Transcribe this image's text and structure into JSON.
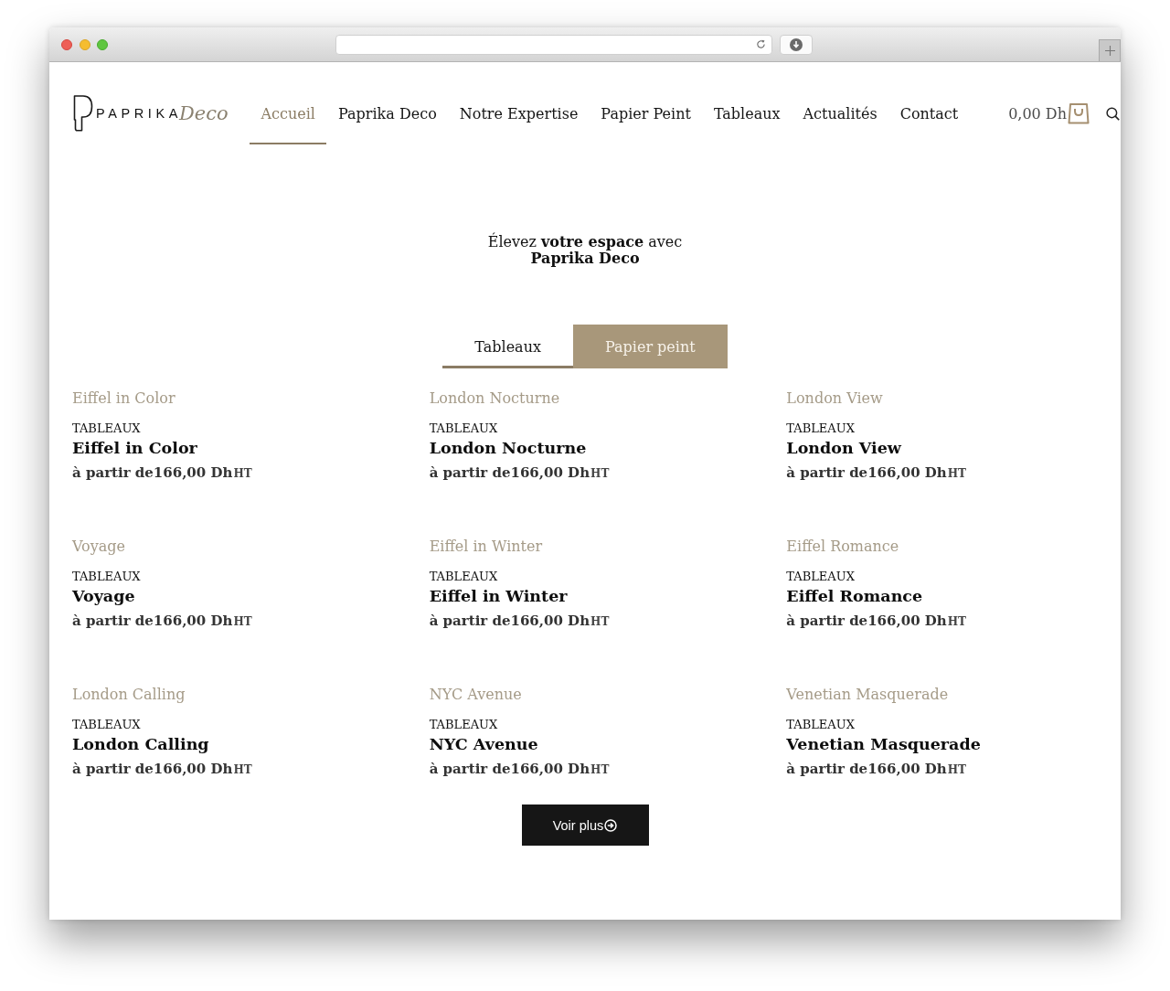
{
  "header": {
    "logo": {
      "wordmark": "PAPRIKA",
      "script": "Deco"
    },
    "nav": [
      {
        "label": "Accueil",
        "selected": true
      },
      {
        "label": "Paprika Deco",
        "selected": false
      },
      {
        "label": "Notre Expertise",
        "selected": false
      },
      {
        "label": "Papier Peint",
        "selected": false
      },
      {
        "label": "Tableaux",
        "selected": false
      },
      {
        "label": "Actualités",
        "selected": false
      },
      {
        "label": "Contact",
        "selected": false
      }
    ],
    "cart": {
      "total": "0,00 Dh"
    }
  },
  "hero": {
    "headline": "Élevez **votre espace** avec **Paprika Deco**"
  },
  "tabs": [
    {
      "label": "Tableaux",
      "selected": true
    },
    {
      "label": "Papier peint",
      "selected": false
    }
  ],
  "products": [
    {
      "image_alt": "Eiffel in Color",
      "category": "TABLEAUX",
      "name": "Eiffel in Color",
      "price": "à partir de166,00 Dh",
      "unit": "HT"
    },
    {
      "image_alt": "London Nocturne",
      "category": "TABLEAUX",
      "name": "London Nocturne",
      "price": "à partir de166,00 Dh",
      "unit": "HT"
    },
    {
      "image_alt": "London View",
      "category": "TABLEAUX",
      "name": "London View",
      "price": "à partir de166,00 Dh",
      "unit": "HT"
    },
    {
      "image_alt": "Voyage",
      "category": "TABLEAUX",
      "name": "Voyage",
      "price": "à partir de166,00 Dh",
      "unit": "HT"
    },
    {
      "image_alt": "Eiffel in Winter",
      "category": "TABLEAUX",
      "name": "Eiffel in Winter",
      "price": "à partir de166,00 Dh",
      "unit": "HT"
    },
    {
      "image_alt": "Eiffel Romance",
      "category": "TABLEAUX",
      "name": "Eiffel Romance",
      "price": "à partir de166,00 Dh",
      "unit": "HT"
    },
    {
      "image_alt": "London Calling",
      "category": "TABLEAUX",
      "name": "London Calling",
      "price": "à partir de166,00 Dh",
      "unit": "HT"
    },
    {
      "image_alt": "NYC Avenue",
      "category": "TABLEAUX",
      "name": "NYC Avenue",
      "price": "à partir de166,00 Dh",
      "unit": "HT"
    },
    {
      "image_alt": "Venetian Masquerade",
      "category": "TABLEAUX",
      "name": "Venetian Masquerade",
      "price": "à partir de166,00 Dh",
      "unit": "HT"
    }
  ],
  "load_more": {
    "label": "Voir plus"
  }
}
